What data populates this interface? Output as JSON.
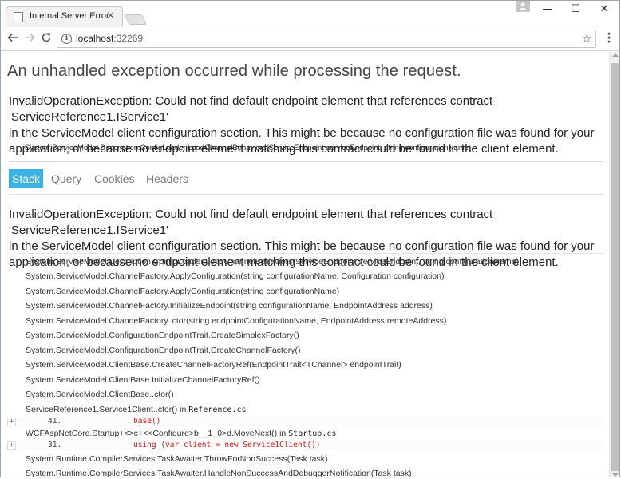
{
  "browser": {
    "tab_title": "Internal Server Error",
    "tab_close": "×",
    "window_controls": {
      "minimize": "—",
      "maximize": "☐",
      "close": "✕"
    },
    "url_host": "localhost",
    "url_port": ":32269",
    "icons": [
      "back-arrow-icon",
      "forward-arrow-icon",
      "reload-icon",
      "info-icon",
      "star-icon",
      "menu-icon",
      "profile-icon"
    ]
  },
  "page": {
    "heading": "An unhandled exception occurred while processing the request.",
    "exception_message_lines": [
      "InvalidOperationException: Could not find default endpoint element that references contract 'ServiceReference1.IService1'",
      "in the ServiceModel client configuration section. This might be because no configuration file was found for your",
      "application, or because no endpoint element matching this contract could be found in the client element."
    ],
    "exception_location": "System.ServiceModel.Description.ConfigLoader.LoadChannelBehaviors(ServiceEndpoint serviceEndpoint, string configurationName)",
    "tabs": [
      {
        "label": "Stack",
        "active": true
      },
      {
        "label": "Query",
        "active": false
      },
      {
        "label": "Cookies",
        "active": false
      },
      {
        "label": "Headers",
        "active": false
      }
    ],
    "stack_message_lines": [
      "InvalidOperationException: Could not find default endpoint element that references contract 'ServiceReference1.IService1'",
      "in the ServiceModel client configuration section. This might be because no configuration file was found for your",
      "application, or because no endpoint element matching this contract could be found in the client element."
    ],
    "frames": [
      {
        "method": "System.ServiceModel.Description.ConfigLoader.LoadChannelBehaviors(ServiceEndpoint serviceEndpoint, string configurationName)"
      },
      {
        "method": "System.ServiceModel.ChannelFactory.ApplyConfiguration(string configurationName, Configuration configuration)"
      },
      {
        "method": "System.ServiceModel.ChannelFactory.ApplyConfiguration(string configurationName)"
      },
      {
        "method": "System.ServiceModel.ChannelFactory.InitializeEndpoint(string configurationName, EndpointAddress address)"
      },
      {
        "method": "System.ServiceModel.ChannelFactory..ctor(string endpointConfigurationName, EndpointAddress remoteAddress)"
      },
      {
        "method": "System.ServiceModel.ConfigurationEndpointTrait.CreateSimplexFactory()"
      },
      {
        "method": "System.ServiceModel.ConfigurationEndpointTrait.CreateChannelFactory()"
      },
      {
        "method": "System.ServiceModel.ClientBase.CreateChannelFactoryRef(EndpointTrait<TChannel> endpointTrait)"
      },
      {
        "method": "System.ServiceModel.ClientBase.InitializeChannelFactoryRef()"
      },
      {
        "method": "System.ServiceModel.ClientBase..ctor()"
      },
      {
        "method": "ServiceReference1.Service1Client..ctor() in ",
        "file": "Reference.cs",
        "line": "41.",
        "code": "base()"
      },
      {
        "method": "WCFAspNetCore.Startup+<>c+<<Configure>b__1_0>d.MoveNext() in ",
        "file": "Startup.cs",
        "line": "31.",
        "code": "using (var client = new Service1Client())"
      },
      {
        "method": "System.Runtime.CompilerServices.TaskAwaiter.ThrowForNonSuccess(Task task)"
      },
      {
        "method": "System.Runtime.CompilerServices.TaskAwaiter.HandleNonSuccessAndDebuggerNotification(Task task)"
      }
    ],
    "expand_label": "+"
  },
  "colors": {
    "active_tab": "#39b2e6",
    "code_text": "#d21b1b"
  }
}
